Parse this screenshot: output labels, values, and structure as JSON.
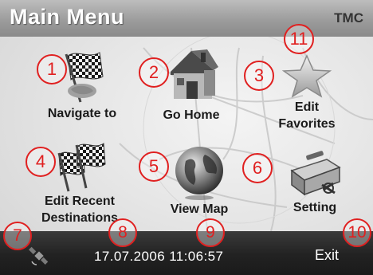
{
  "header": {
    "title": "Main Menu",
    "status": "TMC"
  },
  "menu": {
    "navigate": {
      "label": "Navigate to",
      "icon": "checkered-flag-icon",
      "badge": "1"
    },
    "home": {
      "label": "Go Home",
      "icon": "house-icon",
      "badge": "2"
    },
    "favorites": {
      "label_line1": "Edit",
      "label_line2": "Favorites",
      "icon": "star-icon",
      "badge": "3"
    },
    "recent": {
      "label_line1": "Edit Recent",
      "label_line2": "Destinations",
      "icon": "checkered-flags-icon",
      "badge": "4"
    },
    "viewmap": {
      "label": "View Map",
      "icon": "globe-icon",
      "badge": "5"
    },
    "setting": {
      "label": "Setting",
      "icon": "toolbox-icon",
      "badge": "6"
    }
  },
  "bottombar": {
    "gps_icon": "satellite-icon",
    "datetime": "17.07.2006 11:06:57",
    "exit_label": "Exit",
    "badge_gps": "7",
    "badge_datetime": "8",
    "badge_middle": "9",
    "badge_exit": "10"
  },
  "badge_top": "11",
  "colors": {
    "annotation": "#e02020",
    "header": "#9c9c9c",
    "bottombar": "#222222"
  }
}
